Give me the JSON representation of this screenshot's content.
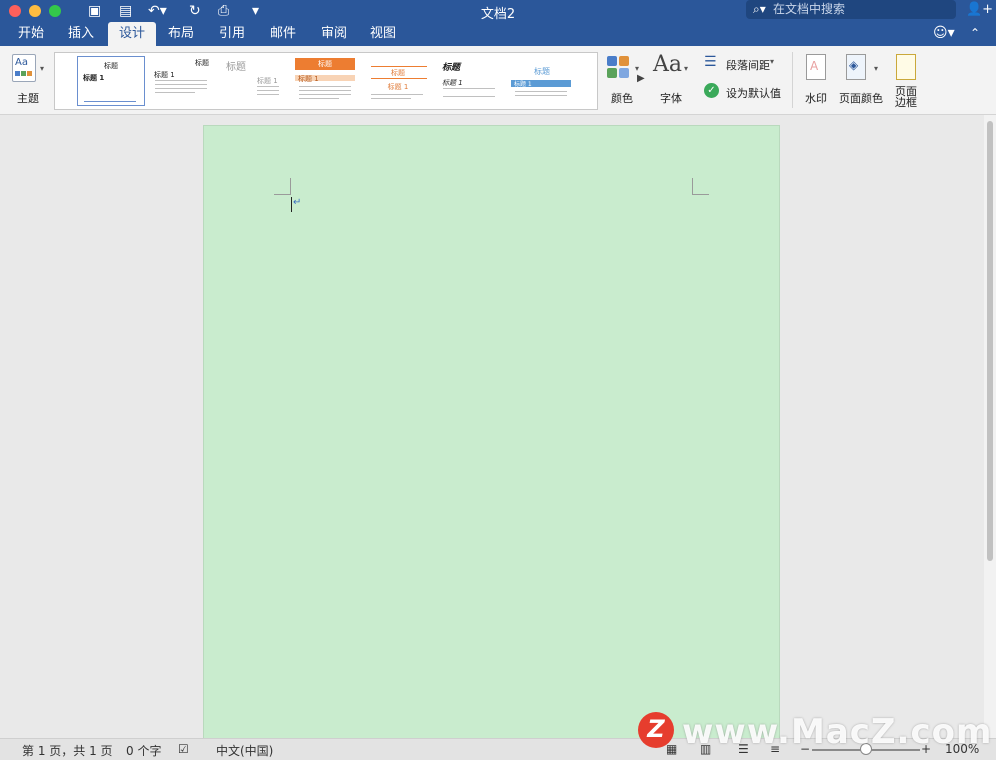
{
  "window": {
    "title": "文档2"
  },
  "search": {
    "placeholder": "在文档中搜索",
    "icon": "search-icon"
  },
  "tabs": [
    {
      "label": "开始",
      "active": false
    },
    {
      "label": "插入",
      "active": false
    },
    {
      "label": "设计",
      "active": true
    },
    {
      "label": "布局",
      "active": false
    },
    {
      "label": "引用",
      "active": false
    },
    {
      "label": "邮件",
      "active": false
    },
    {
      "label": "审阅",
      "active": false
    },
    {
      "label": "视图",
      "active": false
    }
  ],
  "ribbon": {
    "theme_label": "主题",
    "colors_label": "颜色",
    "fonts_label": "字体",
    "fonts_glyph": "Aa",
    "theme_glyph": "Aa",
    "paragraph_spacing_label": "段落间距",
    "set_default_label": "设为默认值",
    "watermark_label": "水印",
    "page_color_label": "页面颜色",
    "page_border_label_1": "页面",
    "page_border_label_2": "边框",
    "style_gallery": {
      "thumb1_title": "标题",
      "thumb1_heading": "标题 1",
      "thumb2_title": "标题",
      "thumb2_heading": "标题 1",
      "thumb3_title": "标题",
      "thumb3_heading": "标题 1",
      "thumb4_title": "标题",
      "thumb4_heading": "标题 1",
      "thumb5_title": "标题",
      "thumb5_heading": "标题 1",
      "thumb6_title": "标题",
      "thumb6_heading": "标题 1",
      "thumb7_title": "标题",
      "thumb7_heading": "标题 1"
    }
  },
  "document": {
    "page_color": "#c9ecce",
    "paragraph_mark": "↵"
  },
  "status": {
    "page_info": "第 1 页，共 1 页",
    "word_count": "0 个字",
    "language": "中文(中国)",
    "zoom": "100%",
    "zoom_level_percent": 100
  },
  "watermark_overlay": {
    "logo_letter": "Z",
    "text": "www.MacZ.com"
  },
  "colors": {
    "accent": "#2b579a",
    "page": "#c9ecce"
  }
}
